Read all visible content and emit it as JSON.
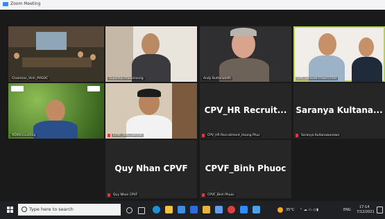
{
  "window": {
    "title": "Zoom Meeting"
  },
  "participants": [
    {
      "name": "Chairman_Vinh_PVGOC",
      "muted": false
    },
    {
      "name": "Supachai Prasomsong",
      "muted": false
    },
    {
      "name": "Andy Butterworth",
      "muted": false
    },
    {
      "name": "CPV_Surasak-Thaisri(TSS)",
      "muted": false
    },
    {
      "name": "ADVAccounting",
      "muted": false
    },
    {
      "name": "CPVF_Hieu_Recruit",
      "muted": true
    },
    {
      "name": "CPV_HR Recruitment_Hoang Phuc",
      "display": "CPV_HR Recruit...",
      "muted": true
    },
    {
      "name": "Saranya Kultanawonawn",
      "display": "Saranya Kultana...",
      "muted": true
    },
    {
      "name": "Quy Nhon CPVF",
      "display": "Quy Nhan CPVF",
      "muted": true
    },
    {
      "name": "CPVF_Binh Phuoc",
      "display": "CPVF_Binh Phuoc",
      "muted": true
    }
  ],
  "taskbar": {
    "search_placeholder": "Type here to search",
    "weather": "35°C",
    "language": "ENG",
    "time": "17:14",
    "date": "7/12/2021"
  },
  "colors": {
    "active_speaker": "#b7d24a",
    "muted_mic": "#e23a3a",
    "taskbar": "#202124"
  }
}
